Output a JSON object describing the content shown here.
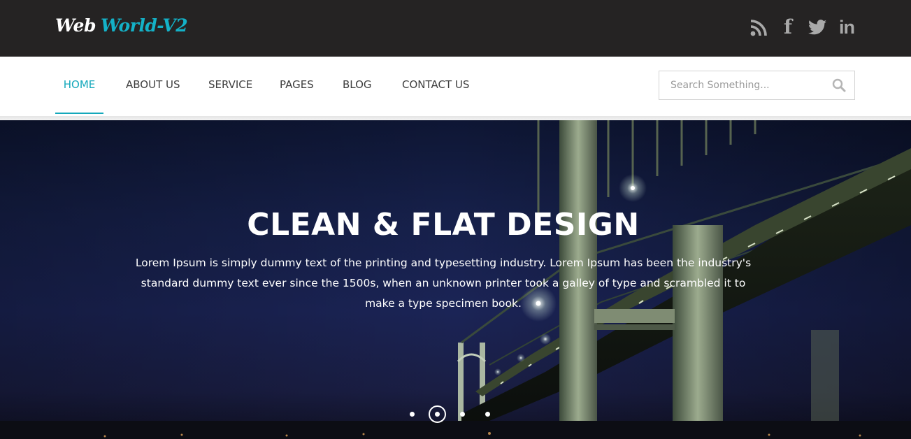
{
  "header": {
    "logo_part1": "Web",
    "logo_part2": "World-V2",
    "social_icons": [
      "rss-icon",
      "facebook-icon",
      "twitter-icon",
      "linkedin-icon"
    ],
    "facebook_glyph": "f",
    "linkedin_glyph": "in"
  },
  "nav": {
    "items": [
      {
        "label": "HOME",
        "active": true
      },
      {
        "label": "ABOUT US",
        "active": false
      },
      {
        "label": "SERVICE",
        "active": false
      },
      {
        "label": "PAGES",
        "active": false
      },
      {
        "label": "BLOG",
        "active": false
      },
      {
        "label": "CONTACT US",
        "active": false
      }
    ],
    "search_placeholder": "Search Something..."
  },
  "hero": {
    "title": "CLEAN & FLAT DESIGN",
    "text": "Lorem Ipsum is simply dummy text of the printing and typesetting industry. Lorem Ipsum has been the industry's standard dummy text ever since the 1500s, when an unknown printer took a galley of type and scrambled it to make a type specimen book.",
    "slide_count": 4,
    "active_slide": 2
  },
  "colors": {
    "accent": "#14a8bb",
    "topbar_bg": "#252323",
    "social_icon": "#a9a9a9",
    "nav_text": "#3e3e3e"
  }
}
